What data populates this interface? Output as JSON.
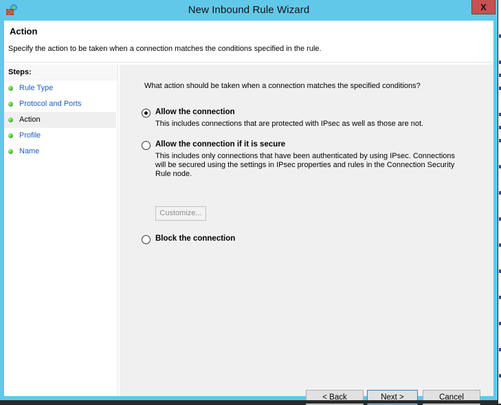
{
  "window": {
    "title": "New Inbound Rule Wizard",
    "close_label": "X",
    "app_icon": "firewall-icon"
  },
  "header": {
    "title": "Action",
    "description": "Specify the action to be taken when a connection matches the conditions specified in the rule."
  },
  "steps": {
    "heading": "Steps:",
    "items": [
      {
        "label": "Rule Type",
        "current": false
      },
      {
        "label": "Protocol and Ports",
        "current": false
      },
      {
        "label": "Action",
        "current": true
      },
      {
        "label": "Profile",
        "current": false
      },
      {
        "label": "Name",
        "current": false
      }
    ]
  },
  "main": {
    "question": "What action should be taken when a connection matches the specified conditions?",
    "options": [
      {
        "label": "Allow the connection",
        "description": "This includes connections that are protected with IPsec as well as those are not.",
        "selected": true
      },
      {
        "label": "Allow the connection if it is secure",
        "description": "This includes only connections that have been authenticated by using IPsec.  Connections will be secured using the settings in IPsec properties and rules in the Connection Security Rule node.",
        "selected": false
      },
      {
        "label": "Block the connection",
        "description": "",
        "selected": false
      }
    ],
    "customize_label": "Customize...",
    "customize_enabled": false
  },
  "footer": {
    "back_label": "< Back",
    "next_label": "Next >",
    "cancel_label": "Cancel"
  },
  "colors": {
    "frame": "#62c8ea",
    "close": "#c75050",
    "link": "#1a5bc4",
    "panel": "#f0f0f0"
  }
}
